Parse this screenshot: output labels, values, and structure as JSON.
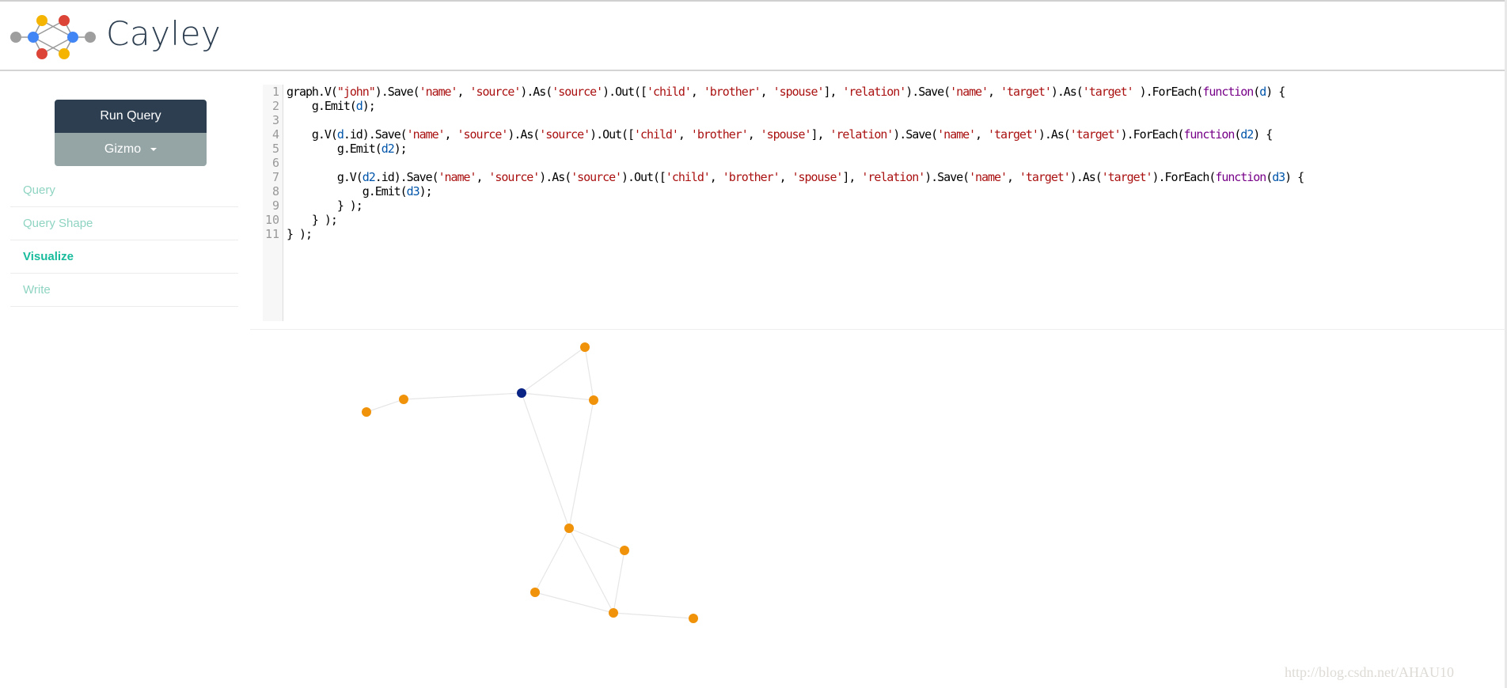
{
  "app": {
    "title": "Cayley",
    "logo_icon": "graph-network-logo"
  },
  "sidebar": {
    "run_query_label": "Run Query",
    "language_label": "Gizmo",
    "nav": [
      {
        "label": "Query",
        "active": false
      },
      {
        "label": "Query Shape",
        "active": false
      },
      {
        "label": "Visualize",
        "active": true
      },
      {
        "label": "Write",
        "active": false
      }
    ]
  },
  "editor": {
    "line_numbers": [
      "1",
      "2",
      "3",
      "4",
      "5",
      "6",
      "7",
      "8",
      "9",
      "10",
      "11"
    ],
    "lines": [
      [
        [
          "",
          "graph.V("
        ],
        [
          "s",
          "\"john\""
        ],
        [
          "",
          ").Save("
        ],
        [
          "s",
          "'name'"
        ],
        [
          "",
          ", "
        ],
        [
          "s",
          "'source'"
        ],
        [
          "",
          ").As("
        ],
        [
          "s",
          "'source'"
        ],
        [
          "",
          ").Out(["
        ],
        [
          "s",
          "'child'"
        ],
        [
          "",
          ", "
        ],
        [
          "s",
          "'brother'"
        ],
        [
          "",
          ", "
        ],
        [
          "s",
          "'spouse'"
        ],
        [
          "",
          "], "
        ],
        [
          "s",
          "'relation'"
        ],
        [
          "",
          ").Save("
        ],
        [
          "s",
          "'name'"
        ],
        [
          "",
          ", "
        ],
        [
          "s",
          "'target'"
        ],
        [
          "",
          ").As("
        ],
        [
          "s",
          "'target'"
        ],
        [
          "",
          " ).ForEach("
        ],
        [
          "k",
          "function"
        ],
        [
          "",
          "("
        ],
        [
          "v",
          "d"
        ],
        [
          "",
          ") {"
        ]
      ],
      [
        [
          "",
          "    g.Emit("
        ],
        [
          "v",
          "d"
        ],
        [
          "",
          ");"
        ]
      ],
      [
        [
          "",
          ""
        ]
      ],
      [
        [
          "",
          "    g.V("
        ],
        [
          "v",
          "d"
        ],
        [
          "",
          ".id).Save("
        ],
        [
          "s",
          "'name'"
        ],
        [
          "",
          ", "
        ],
        [
          "s",
          "'source'"
        ],
        [
          "",
          ").As("
        ],
        [
          "s",
          "'source'"
        ],
        [
          "",
          ").Out(["
        ],
        [
          "s",
          "'child'"
        ],
        [
          "",
          ", "
        ],
        [
          "s",
          "'brother'"
        ],
        [
          "",
          ", "
        ],
        [
          "s",
          "'spouse'"
        ],
        [
          "",
          "], "
        ],
        [
          "s",
          "'relation'"
        ],
        [
          "",
          ").Save("
        ],
        [
          "s",
          "'name'"
        ],
        [
          "",
          ", "
        ],
        [
          "s",
          "'target'"
        ],
        [
          "",
          ").As("
        ],
        [
          "s",
          "'target'"
        ],
        [
          "",
          ").ForEach("
        ],
        [
          "k",
          "function"
        ],
        [
          "",
          "("
        ],
        [
          "v",
          "d2"
        ],
        [
          "",
          ") {"
        ]
      ],
      [
        [
          "",
          "        g.Emit("
        ],
        [
          "v",
          "d2"
        ],
        [
          "",
          ");"
        ]
      ],
      [
        [
          "",
          ""
        ]
      ],
      [
        [
          "",
          "        g.V("
        ],
        [
          "v",
          "d2"
        ],
        [
          "",
          ".id).Save("
        ],
        [
          "s",
          "'name'"
        ],
        [
          "",
          ", "
        ],
        [
          "s",
          "'source'"
        ],
        [
          "",
          ").As("
        ],
        [
          "s",
          "'source'"
        ],
        [
          "",
          ").Out(["
        ],
        [
          "s",
          "'child'"
        ],
        [
          "",
          ", "
        ],
        [
          "s",
          "'brother'"
        ],
        [
          "",
          ", "
        ],
        [
          "s",
          "'spouse'"
        ],
        [
          "",
          "], "
        ],
        [
          "s",
          "'relation'"
        ],
        [
          "",
          ").Save("
        ],
        [
          "s",
          "'name'"
        ],
        [
          "",
          ", "
        ],
        [
          "s",
          "'target'"
        ],
        [
          "",
          ").As("
        ],
        [
          "s",
          "'target'"
        ],
        [
          "",
          ").ForEach("
        ],
        [
          "k",
          "function"
        ],
        [
          "",
          "("
        ],
        [
          "v",
          "d3"
        ],
        [
          "",
          ") {"
        ]
      ],
      [
        [
          "",
          "            g.Emit("
        ],
        [
          "v",
          "d3"
        ],
        [
          "",
          ");"
        ]
      ],
      [
        [
          "",
          "        } );"
        ]
      ],
      [
        [
          "",
          "    } );"
        ]
      ],
      [
        [
          "",
          "} );"
        ]
      ]
    ]
  },
  "graph": {
    "colors": {
      "node": "#f0920a",
      "root": "#0a2485",
      "edge": "#e6e6e6"
    },
    "nodes": [
      {
        "id": "n0",
        "root": true
      },
      {
        "id": "n1"
      },
      {
        "id": "n2"
      },
      {
        "id": "n3"
      },
      {
        "id": "n4"
      },
      {
        "id": "n5"
      },
      {
        "id": "n6"
      },
      {
        "id": "n7"
      },
      {
        "id": "n8"
      },
      {
        "id": "n9"
      },
      {
        "id": "n10"
      }
    ],
    "edges": [
      [
        "n0",
        "n1"
      ],
      [
        "n0",
        "n2"
      ],
      [
        "n1",
        "n2"
      ],
      [
        "n0",
        "n3"
      ],
      [
        "n3",
        "n4"
      ],
      [
        "n0",
        "n5"
      ],
      [
        "n2",
        "n5"
      ],
      [
        "n5",
        "n6"
      ],
      [
        "n5",
        "n7"
      ],
      [
        "n5",
        "n8"
      ],
      [
        "n6",
        "n8"
      ],
      [
        "n7",
        "n8"
      ],
      [
        "n8",
        "n9"
      ]
    ]
  },
  "watermark": "http://blog.csdn.net/AHAU10"
}
